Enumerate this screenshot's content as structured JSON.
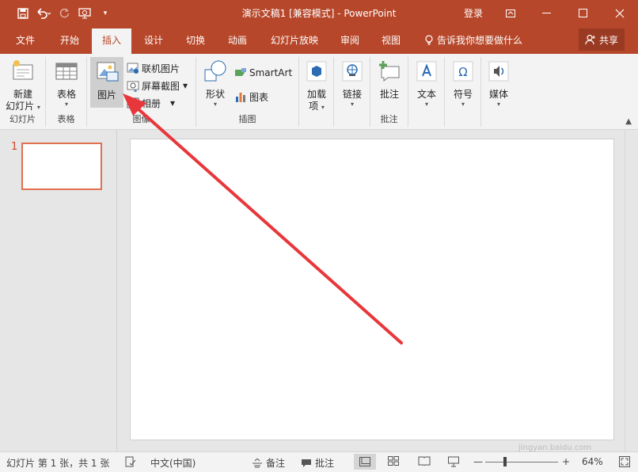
{
  "window": {
    "title": "演示文稿1 [兼容模式] - PowerPoint",
    "login": "登录"
  },
  "tabs": [
    {
      "label": "文件"
    },
    {
      "label": "开始"
    },
    {
      "label": "插入"
    },
    {
      "label": "设计"
    },
    {
      "label": "切换"
    },
    {
      "label": "动画"
    },
    {
      "label": "幻灯片放映"
    },
    {
      "label": "审阅"
    },
    {
      "label": "视图"
    }
  ],
  "tellme": "告诉我你想要做什么",
  "share": "共享",
  "ribbon": {
    "new_slide": "新建",
    "new_slide2": "幻灯片",
    "group_slides": "幻灯片",
    "table": "表格",
    "group_tables": "表格",
    "picture": "图片",
    "online_pictures": "联机图片",
    "screenshot": "屏幕截图",
    "album": "相册",
    "group_images": "图像",
    "shapes": "形状",
    "smartart": "SmartArt",
    "chart": "图表",
    "group_illustrations": "插图",
    "addins": "加载",
    "addins2": "项",
    "link": "链接",
    "comment": "批注",
    "group_comments": "批注",
    "text": "文本",
    "symbols": "符号",
    "media": "媒体"
  },
  "thumbnail": {
    "number": "1"
  },
  "status": {
    "slide_info": "幻灯片 第 1 张，共 1 张",
    "language": "中文(中国)",
    "notes": "备注",
    "comments": "批注",
    "zoom": "64%",
    "zoom_level": 0.64
  },
  "watermark": {
    "text": "Bai 经验",
    "sub": "jingyan.baidu.com"
  },
  "colors": {
    "accent": "#b7472a",
    "arrow": "#e8373b"
  }
}
